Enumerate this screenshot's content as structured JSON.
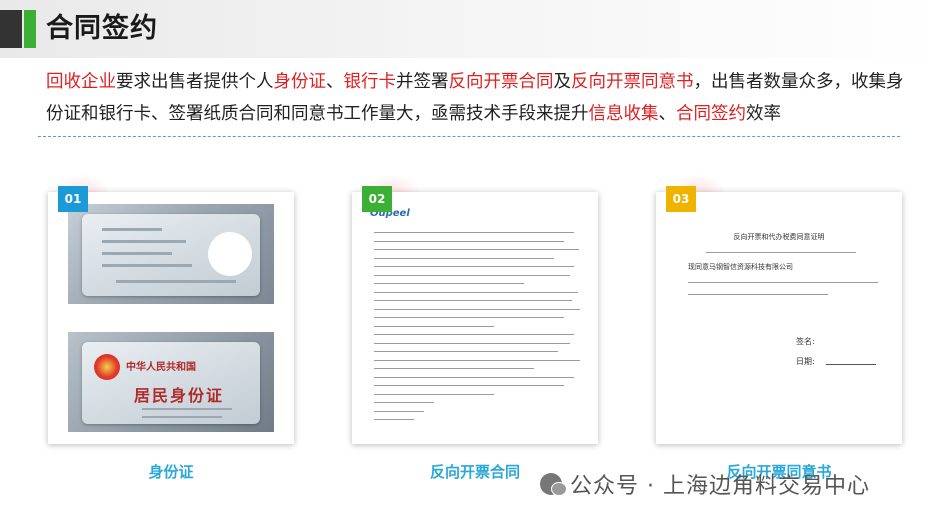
{
  "title": "合同签约",
  "intro": {
    "parts": [
      {
        "text": "回收企业",
        "hl": true
      },
      {
        "text": "要求出售者提供个人",
        "hl": false
      },
      {
        "text": "身份证",
        "hl": true
      },
      {
        "text": "、",
        "hl": false
      },
      {
        "text": "银行卡",
        "hl": true
      },
      {
        "text": "并签署",
        "hl": false
      },
      {
        "text": "反向开票合同",
        "hl": true
      },
      {
        "text": "及",
        "hl": false
      },
      {
        "text": "反向开票同意书",
        "hl": true
      },
      {
        "text": "，出售者数量众多，收集身份证和银行卡、签署纸质合同和同意书工作量大，亟需技术手段来提升",
        "hl": false
      },
      {
        "text": "信息收集",
        "hl": true
      },
      {
        "text": "、",
        "hl": false
      },
      {
        "text": "合同签约",
        "hl": true
      },
      {
        "text": "效率",
        "hl": false
      }
    ]
  },
  "cards": [
    {
      "badge": "01",
      "caption": "身份证",
      "badge_color": "#1a9ad6"
    },
    {
      "badge": "02",
      "caption": "反向开票合同",
      "badge_color": "#3cb034"
    },
    {
      "badge": "03",
      "caption": "反向开票同意书",
      "badge_color": "#f0b400"
    }
  ],
  "id_back": {
    "line1": "中华人民共和国",
    "line2": "居民身份证"
  },
  "contract": {
    "logo": "Oupeel"
  },
  "consent": {
    "heading": "反向开票和代办税费同意证明",
    "company": "现同意马钢智信资源科技有限公司",
    "sign_label": "签名:",
    "date_label": "日期:"
  },
  "watermark": "公众号 · 上海边角料交易中心",
  "colors": {
    "highlight": "#e02020",
    "caption": "#2aa8d8",
    "accent_green": "#3cb034"
  }
}
